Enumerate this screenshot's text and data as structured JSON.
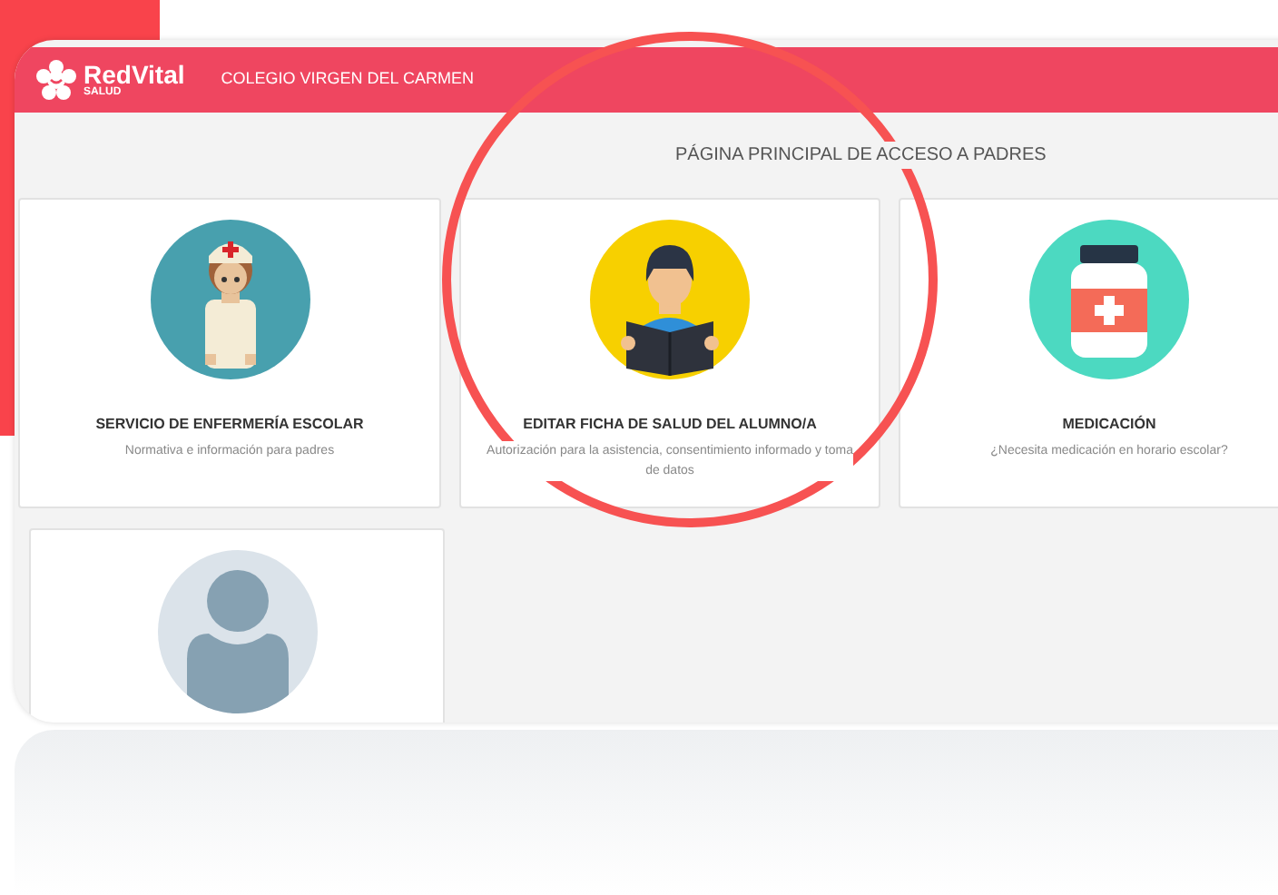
{
  "header": {
    "logo_name": "RedVital",
    "logo_sub": "SALUD",
    "school": "COLEGIO VIRGEN DEL CARMEN"
  },
  "page_title": "PÁGINA PRINCIPAL DE ACCESO A PADRES",
  "cards": [
    {
      "kind": "nurse",
      "title": "SERVICIO DE ENFERMERÍA ESCOLAR",
      "subtitle": "Normativa e información para padres"
    },
    {
      "kind": "student",
      "title": "EDITAR FICHA DE SALUD DEL ALUMNO/A",
      "subtitle": "Autorización para la asistencia, consentimiento informado y toma de datos"
    },
    {
      "kind": "medicine",
      "title": "MEDICACIÓN",
      "subtitle": "¿Necesita medicación en horario escolar?"
    },
    {
      "kind": "user"
    }
  ]
}
